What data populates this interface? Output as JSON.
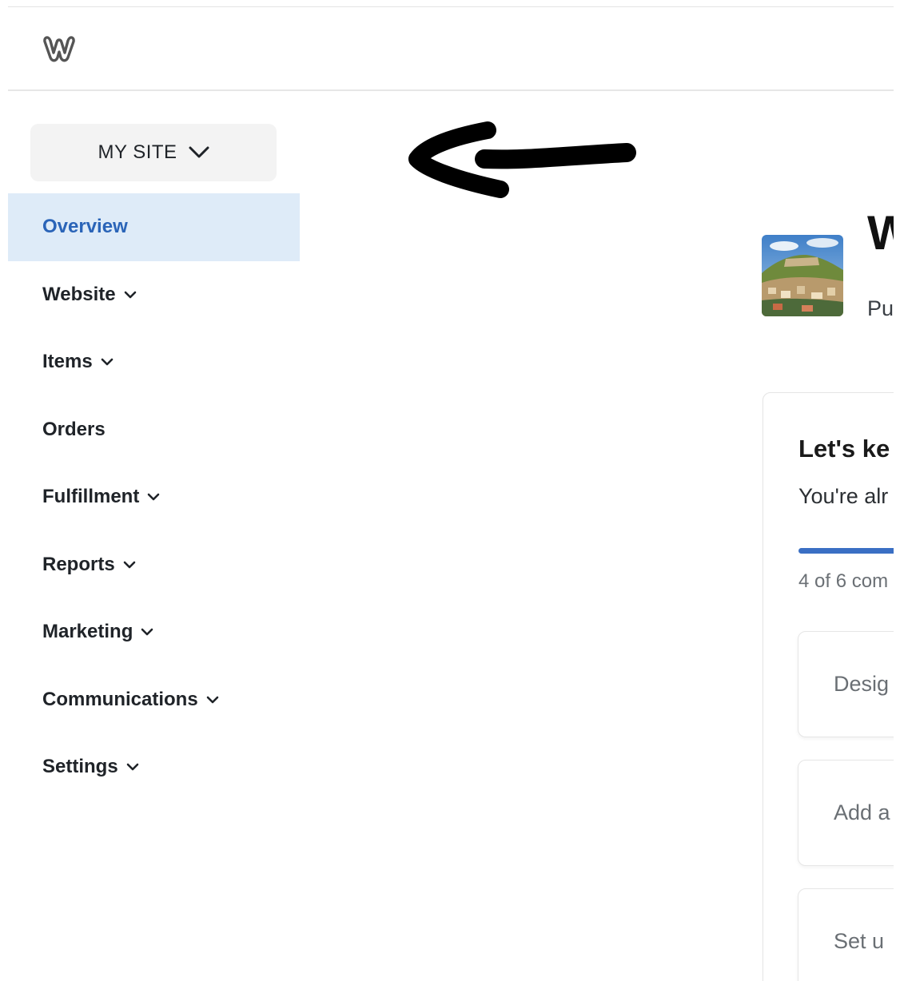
{
  "header": {
    "logo_icon": "weebly-logo-icon"
  },
  "site_switcher": {
    "label": "MY SITE",
    "icon": "chevron-down-icon"
  },
  "sidebar": {
    "items": [
      {
        "label": "Overview",
        "active": true,
        "expandable": false
      },
      {
        "label": "Website",
        "active": false,
        "expandable": true
      },
      {
        "label": "Items",
        "active": false,
        "expandable": true
      },
      {
        "label": "Orders",
        "active": false,
        "expandable": false
      },
      {
        "label": "Fulfillment",
        "active": false,
        "expandable": true
      },
      {
        "label": "Reports",
        "active": false,
        "expandable": true
      },
      {
        "label": "Marketing",
        "active": false,
        "expandable": true
      },
      {
        "label": "Communications",
        "active": false,
        "expandable": true
      },
      {
        "label": "Settings",
        "active": false,
        "expandable": true
      }
    ]
  },
  "site": {
    "title": "W",
    "status": "Pu"
  },
  "setup": {
    "title": "Let's ke",
    "subtitle": "You're alr",
    "progress_fraction": 0.667,
    "progress_text": "4 of 6 com",
    "tasks": [
      {
        "label": "Desig"
      },
      {
        "label": "Add a"
      },
      {
        "label": "Set u"
      }
    ]
  },
  "colors": {
    "accent": "#2a64b8",
    "active_bg": "#deebf8",
    "progress": "#3a6fc4"
  }
}
